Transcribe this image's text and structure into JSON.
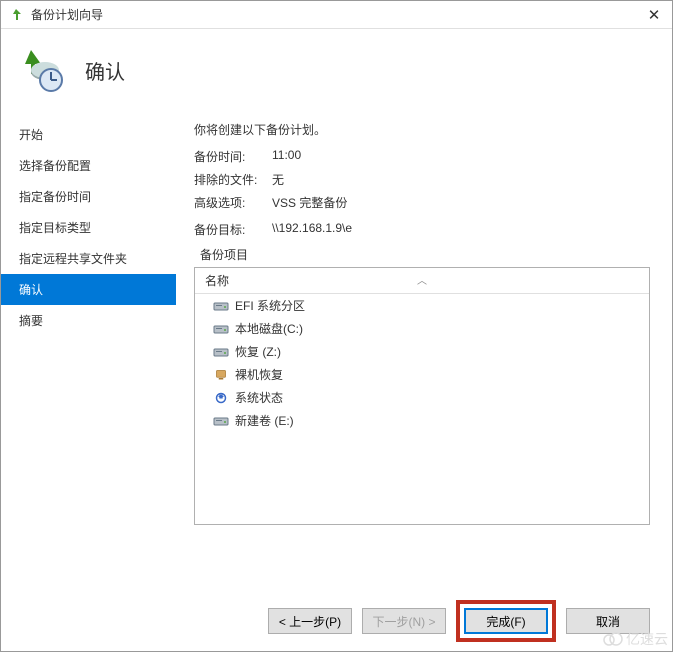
{
  "titlebar": {
    "title": "备份计划向导"
  },
  "header": {
    "title": "确认"
  },
  "sidebar": {
    "items": [
      {
        "label": "开始"
      },
      {
        "label": "选择备份配置"
      },
      {
        "label": "指定备份时间"
      },
      {
        "label": "指定目标类型"
      },
      {
        "label": "指定远程共享文件夹"
      },
      {
        "label": "确认"
      },
      {
        "label": "摘要"
      }
    ],
    "selectedIndex": 5
  },
  "content": {
    "intro": "你将创建以下备份计划。",
    "fields": {
      "backup_time_label": "备份时间:",
      "backup_time_value": "11:00",
      "exclude_label": "排除的文件:",
      "exclude_value": "无",
      "advanced_label": "高级选项:",
      "advanced_value": "VSS 完整备份",
      "target_label": "备份目标:",
      "target_value": "\\\\192.168.1.9\\e"
    },
    "items_label": "备份项目",
    "list_header": "名称",
    "items": [
      {
        "icon": "drive",
        "label": "EFI 系统分区"
      },
      {
        "icon": "drive",
        "label": "本地磁盘(C:)"
      },
      {
        "icon": "drive",
        "label": "恢复 (Z:)"
      },
      {
        "icon": "bare",
        "label": "裸机恢复"
      },
      {
        "icon": "system",
        "label": "系统状态"
      },
      {
        "icon": "drive",
        "label": "新建卷 (E:)"
      }
    ]
  },
  "footer": {
    "prev_label": "< 上一步(P)",
    "next_label": "下一步(N) >",
    "finish_label": "完成(F)",
    "cancel_label": "取消"
  },
  "watermark": "亿速云"
}
